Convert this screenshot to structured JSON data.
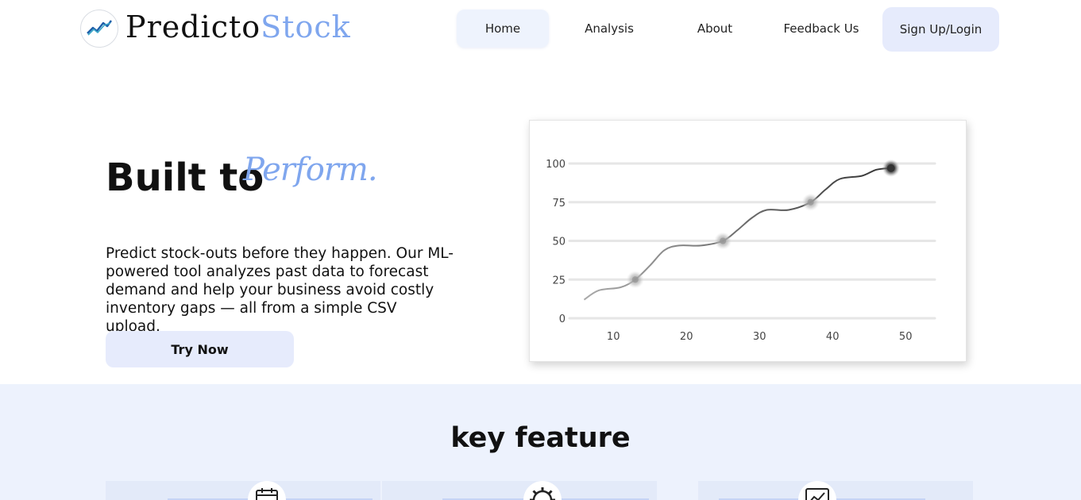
{
  "brand": {
    "name_part1": "Predicto",
    "name_part2": "Stock",
    "logo_icon": "trend-chart-icon",
    "accent_color": "#7fa6ee"
  },
  "nav": {
    "items": [
      {
        "label": "Home",
        "active": true
      },
      {
        "label": "Analysis",
        "active": false
      },
      {
        "label": "About",
        "active": false
      },
      {
        "label": "Feedback Us",
        "active": false
      }
    ],
    "signup_label": "Sign Up/Login"
  },
  "hero": {
    "title": "Built to",
    "title_accent": "Perform.",
    "description": "Predict stock-outs before they happen. Our ML-powered tool analyzes past data to forecast demand and help your business avoid costly inventory gaps — all from a simple CSV upload.",
    "cta_label": "Try Now"
  },
  "chart_data": {
    "type": "line",
    "x_ticks": [
      10,
      20,
      30,
      40,
      50
    ],
    "y_ticks": [
      0,
      25,
      50,
      75,
      100
    ],
    "xlim": [
      4,
      54
    ],
    "ylim": [
      0,
      100
    ],
    "grid": true,
    "points": [
      {
        "x": 6,
        "y": 12
      },
      {
        "x": 8,
        "y": 18
      },
      {
        "x": 11,
        "y": 20
      },
      {
        "x": 13,
        "y": 25
      },
      {
        "x": 15,
        "y": 34
      },
      {
        "x": 17,
        "y": 44
      },
      {
        "x": 19,
        "y": 47
      },
      {
        "x": 22,
        "y": 47
      },
      {
        "x": 25,
        "y": 50
      },
      {
        "x": 27,
        "y": 57
      },
      {
        "x": 29,
        "y": 65
      },
      {
        "x": 31,
        "y": 70
      },
      {
        "x": 34,
        "y": 70
      },
      {
        "x": 37,
        "y": 75
      },
      {
        "x": 39,
        "y": 83
      },
      {
        "x": 41,
        "y": 90
      },
      {
        "x": 44,
        "y": 92
      },
      {
        "x": 46,
        "y": 96
      },
      {
        "x": 48,
        "y": 97
      }
    ],
    "highlights": [
      {
        "x": 13,
        "y": 25
      },
      {
        "x": 25,
        "y": 50
      },
      {
        "x": 37,
        "y": 75
      },
      {
        "x": 48,
        "y": 97
      }
    ],
    "line_color": "#333333",
    "grid_color": "#e6e6e6"
  },
  "features": {
    "title": "key feature",
    "cards": [
      {
        "icon": "calendar-icon"
      },
      {
        "icon": "ml-gear-icon"
      },
      {
        "icon": "chart-report-icon"
      }
    ],
    "section_bg": "#edf2fd"
  }
}
